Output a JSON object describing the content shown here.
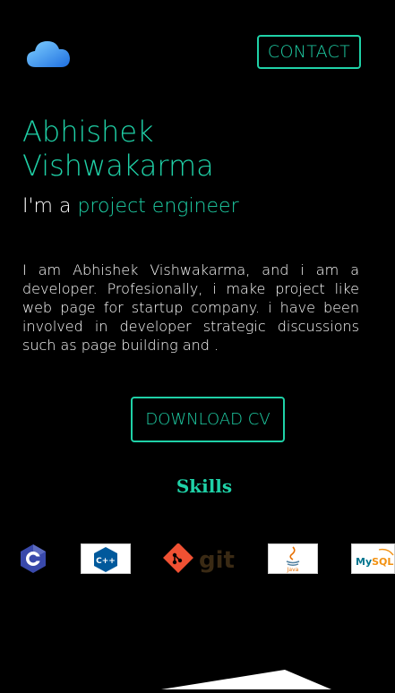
{
  "header": {
    "logo_icon": "cloud-icon",
    "contact_label": "CONTACT"
  },
  "hero": {
    "name": "Abhishek Vishwakarma",
    "role_prefix": "I'm a ",
    "role_highlight": "project engineer",
    "about": "I am Abhishek Vishwakarma, and i am a developer. Profesionally, i make project like web page for startup company. i have been involved in developer strategic discussions such as page building and .",
    "download_label": "DOWNLOAD CV"
  },
  "skills": {
    "title": "Skills",
    "items": [
      {
        "name": "C",
        "icon": "c-logo-icon"
      },
      {
        "name": "C++",
        "icon": "cpp-logo-icon"
      },
      {
        "name": "git",
        "icon": "git-logo-icon"
      },
      {
        "name": "Java",
        "icon": "java-logo-icon"
      },
      {
        "name": "MySQL",
        "icon": "mysql-logo-icon"
      }
    ]
  },
  "colors": {
    "accent": "#1fd1a7",
    "background": "#000000",
    "text": "#ffffff"
  }
}
